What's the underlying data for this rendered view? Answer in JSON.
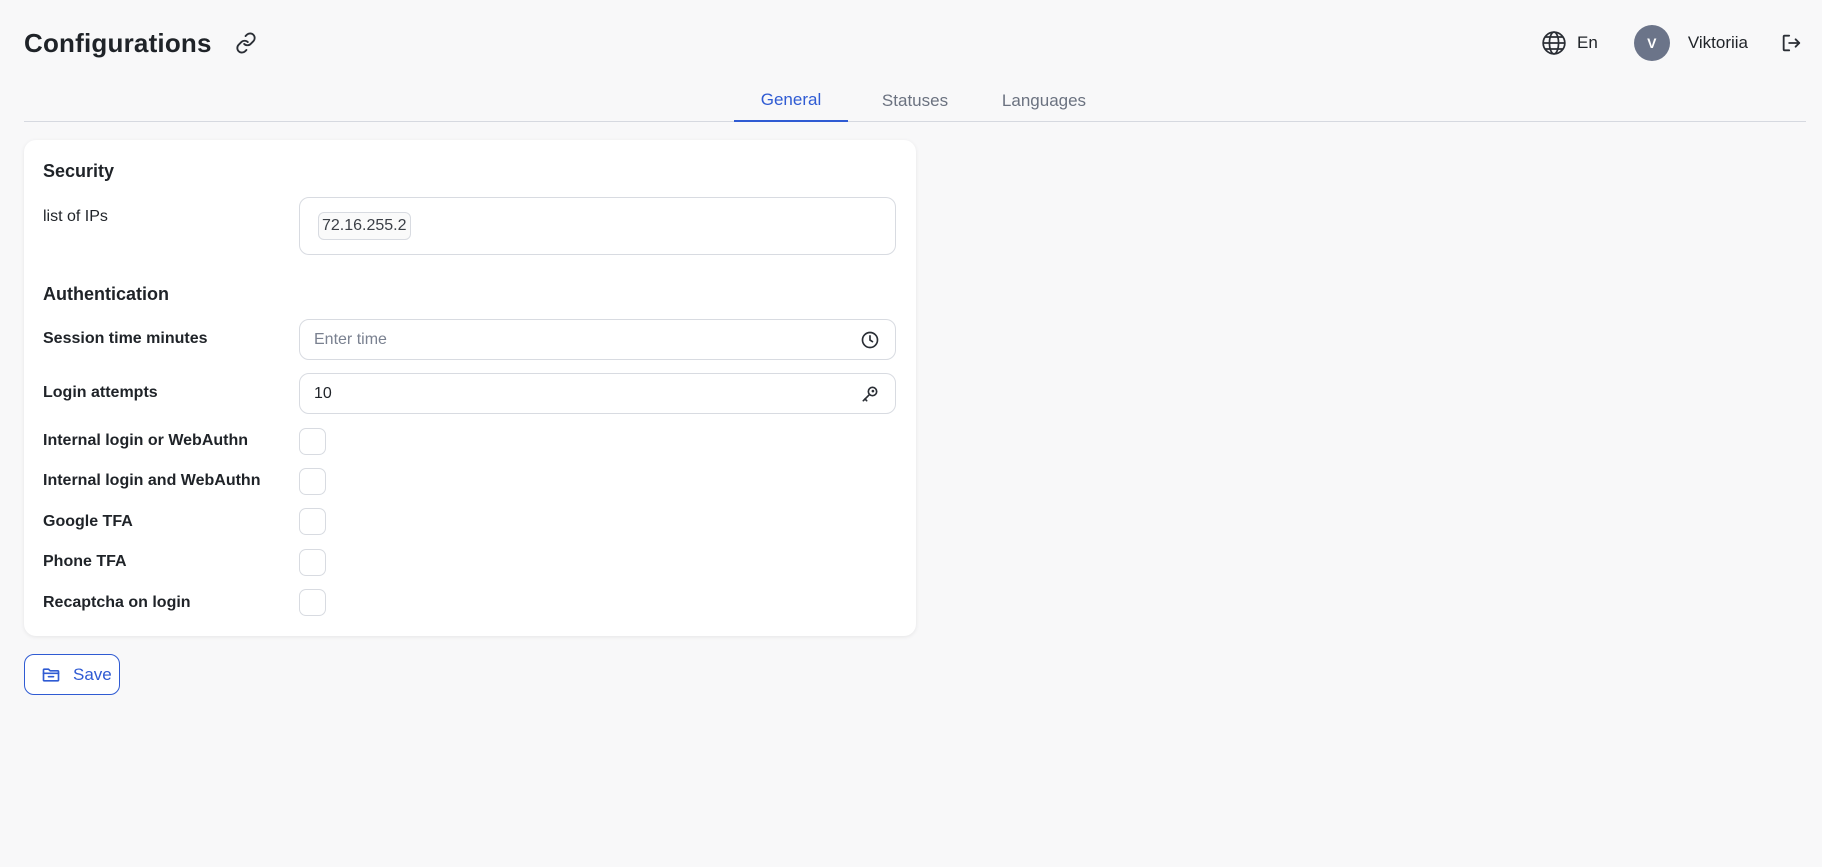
{
  "header": {
    "title": "Configurations",
    "language": "En",
    "user_initial": "V",
    "user_name": "Viktoriia"
  },
  "tabs": [
    {
      "label": "General",
      "active": true
    },
    {
      "label": "Statuses",
      "active": false
    },
    {
      "label": "Languages",
      "active": false
    }
  ],
  "security": {
    "title": "Security",
    "ips_label": "list of IPs",
    "ips": [
      "72.16.255.2"
    ]
  },
  "authentication": {
    "title": "Authentication",
    "session_label": "Session time minutes",
    "session_placeholder": "Enter time",
    "login_attempts_label": "Login attempts",
    "login_attempts_value": "10",
    "checkboxes": [
      {
        "label": "Internal login or WebAuthn",
        "checked": false
      },
      {
        "label": "Internal login and WebAuthn",
        "checked": false
      },
      {
        "label": "Google TFA",
        "checked": false
      },
      {
        "label": "Phone TFA",
        "checked": false
      },
      {
        "label": "Recaptcha on login",
        "checked": false
      }
    ]
  },
  "actions": {
    "save_label": "Save"
  },
  "colors": {
    "accent": "#2f5bd3",
    "avatar": "#6b7489",
    "background": "#f8f8f9"
  }
}
